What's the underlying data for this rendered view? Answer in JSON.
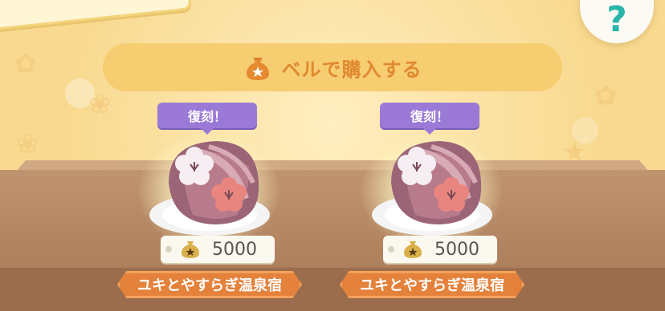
{
  "header": {
    "title": "ベルで購入する",
    "icon": "bell-bag-icon"
  },
  "help": {
    "label": "?"
  },
  "items": [
    {
      "badge": "復刻！",
      "price": "5000",
      "set_name": "ユキとやすらぎ温泉宿",
      "icon": "sakura-cushion-icon"
    },
    {
      "badge": "復刻！",
      "price": "5000",
      "set_name": "ユキとやすらぎ温泉宿",
      "icon": "sakura-cushion-icon"
    }
  ],
  "colors": {
    "accent": "#e0892f",
    "badge": "#9a7ad6",
    "tag": "#e4823c",
    "help": "#2bb5a9"
  }
}
